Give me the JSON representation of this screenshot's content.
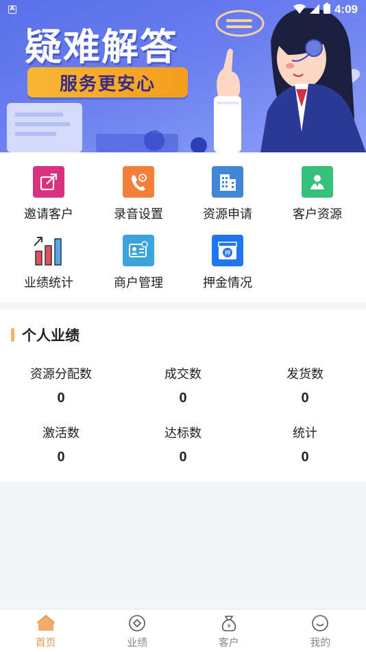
{
  "status_bar": {
    "time": "4:09"
  },
  "banner": {
    "title": "疑难解答",
    "subtitle": "服务更安心"
  },
  "grid": [
    {
      "label": "邀请客户",
      "icon": "share-icon",
      "color": "#d8317e"
    },
    {
      "label": "录音设置",
      "icon": "phone-record-icon",
      "color": "#f47f3a"
    },
    {
      "label": "资源申请",
      "icon": "building-icon",
      "color": "#3f87d6"
    },
    {
      "label": "客户资源",
      "icon": "customer-icon",
      "color": "#37c07a"
    },
    {
      "label": "业绩统计",
      "icon": "bar-chart-icon",
      "color": "#2a3340"
    },
    {
      "label": "商户管理",
      "icon": "id-card-icon",
      "color": "#3aa3dc"
    },
    {
      "label": "押金情况",
      "icon": "deposit-box-icon",
      "color": "#1f76f0"
    }
  ],
  "performance": {
    "title": "个人业绩",
    "stats": [
      {
        "label": "资源分配数",
        "value": "0"
      },
      {
        "label": "成交数",
        "value": "0"
      },
      {
        "label": "发货数",
        "value": "0"
      },
      {
        "label": "激活数",
        "value": "0"
      },
      {
        "label": "达标数",
        "value": "0"
      },
      {
        "label": "统计",
        "value": "0"
      }
    ]
  },
  "nav": [
    {
      "label": "首页",
      "icon": "home-icon",
      "active": true
    },
    {
      "label": "业绩",
      "icon": "performance-icon",
      "active": false
    },
    {
      "label": "客户",
      "icon": "money-bag-icon",
      "active": false
    },
    {
      "label": "我的",
      "icon": "profile-icon",
      "active": false
    }
  ],
  "colors": {
    "accent": "#e49a52",
    "banner": "#6a7ef0",
    "title_bar": "#f2b366"
  }
}
